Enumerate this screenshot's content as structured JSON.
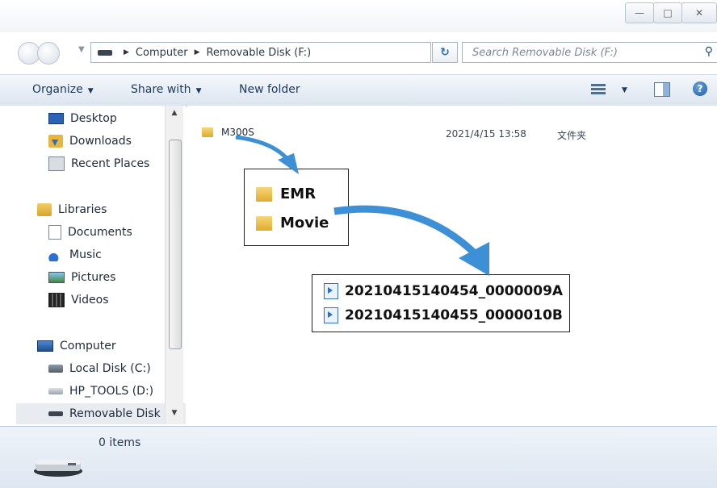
{
  "window": {
    "caption_buttons": {
      "minimize": "—",
      "maximize": "□",
      "close": "✕"
    }
  },
  "address_bar": {
    "crumbs": [
      "Computer",
      "Removable Disk (F:)"
    ],
    "search_placeholder": "Search Removable Disk (F:)"
  },
  "toolbar": {
    "organize": "Organize",
    "share_with": "Share with",
    "new_folder": "New folder",
    "help": "?"
  },
  "navigation": {
    "favorites": [
      "Desktop",
      "Downloads",
      "Recent Places"
    ],
    "libraries_label": "Libraries",
    "libraries": [
      "Documents",
      "Music",
      "Pictures",
      "Videos"
    ],
    "computer_label": "Computer",
    "drives": [
      "Local Disk (C:)",
      "HP_TOOLS (D:)",
      "Removable Disk ("
    ]
  },
  "content": {
    "folder": {
      "name": "M300S",
      "date": "2021/4/15 13:58",
      "type": "文件夹"
    },
    "subfolders": [
      "EMR",
      "Movie"
    ],
    "files": [
      "20210415140454_0000009A",
      "20210415140455_0000010B"
    ]
  },
  "details": {
    "count": "0 items"
  },
  "colors": {
    "accent_arrow": "#3d8fd6",
    "toolbar_text": "#1c3a5e"
  }
}
